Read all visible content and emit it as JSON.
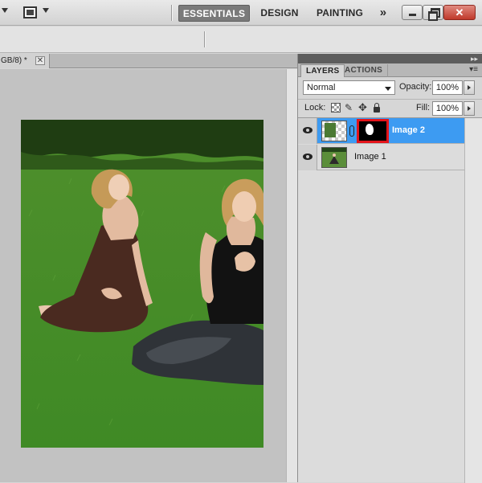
{
  "toolbar": {
    "workspaces": [
      "ESSENTIALS",
      "DESIGN",
      "PAINTING"
    ],
    "more_glyph": "»",
    "close_glyph": "✕"
  },
  "document": {
    "tab_title": "GB/8) *",
    "close_glyph": "✕"
  },
  "layers_panel": {
    "tabs": [
      "LAYERS",
      "ACTIONS"
    ],
    "menu_glyph": "▾≡",
    "blend_mode": "Normal",
    "opacity_label": "Opacity:",
    "opacity_value": "100%",
    "lock_label": "Lock:",
    "fill_label": "Fill:",
    "fill_value": "100%",
    "layers": [
      {
        "name": "Image 2",
        "selected": true,
        "has_mask": true
      },
      {
        "name": "Image 1",
        "selected": false,
        "has_mask": false
      }
    ]
  },
  "colors": {
    "selection": "#3d9bf2",
    "mask_highlight": "#e3141b",
    "active_workspace": "#7a7a7a"
  }
}
